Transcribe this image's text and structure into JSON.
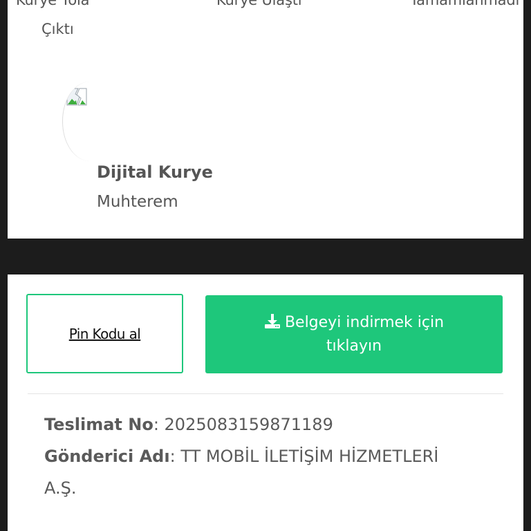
{
  "tracking_steps": [
    {
      "label": "Kurye Yola",
      "label_line2": "Çıktı"
    },
    {
      "label": "Kurye Ulaştı"
    },
    {
      "label": "Tamamlanmadı"
    }
  ],
  "courier": {
    "avatar_icon": "broken-image-icon",
    "name": "Dijital Kurye",
    "subtitle": "Muhterem"
  },
  "actions": {
    "pin_label": "Pin Kodu al",
    "download_icon": "download-icon",
    "download_label": "Belgeyi indirmek için tıklayın"
  },
  "delivery": {
    "number_label": "Teslimat No",
    "number_value": "2025083159871189",
    "sender_label": "Gönderici Adı",
    "sender_value_line1": "TT MOBİL İLETİŞİM HİZMETLERİ",
    "sender_value_line2": "A.Ş."
  },
  "colors": {
    "accent": "#1ec77b",
    "background": "#1c1c1c",
    "text": "#555555"
  }
}
